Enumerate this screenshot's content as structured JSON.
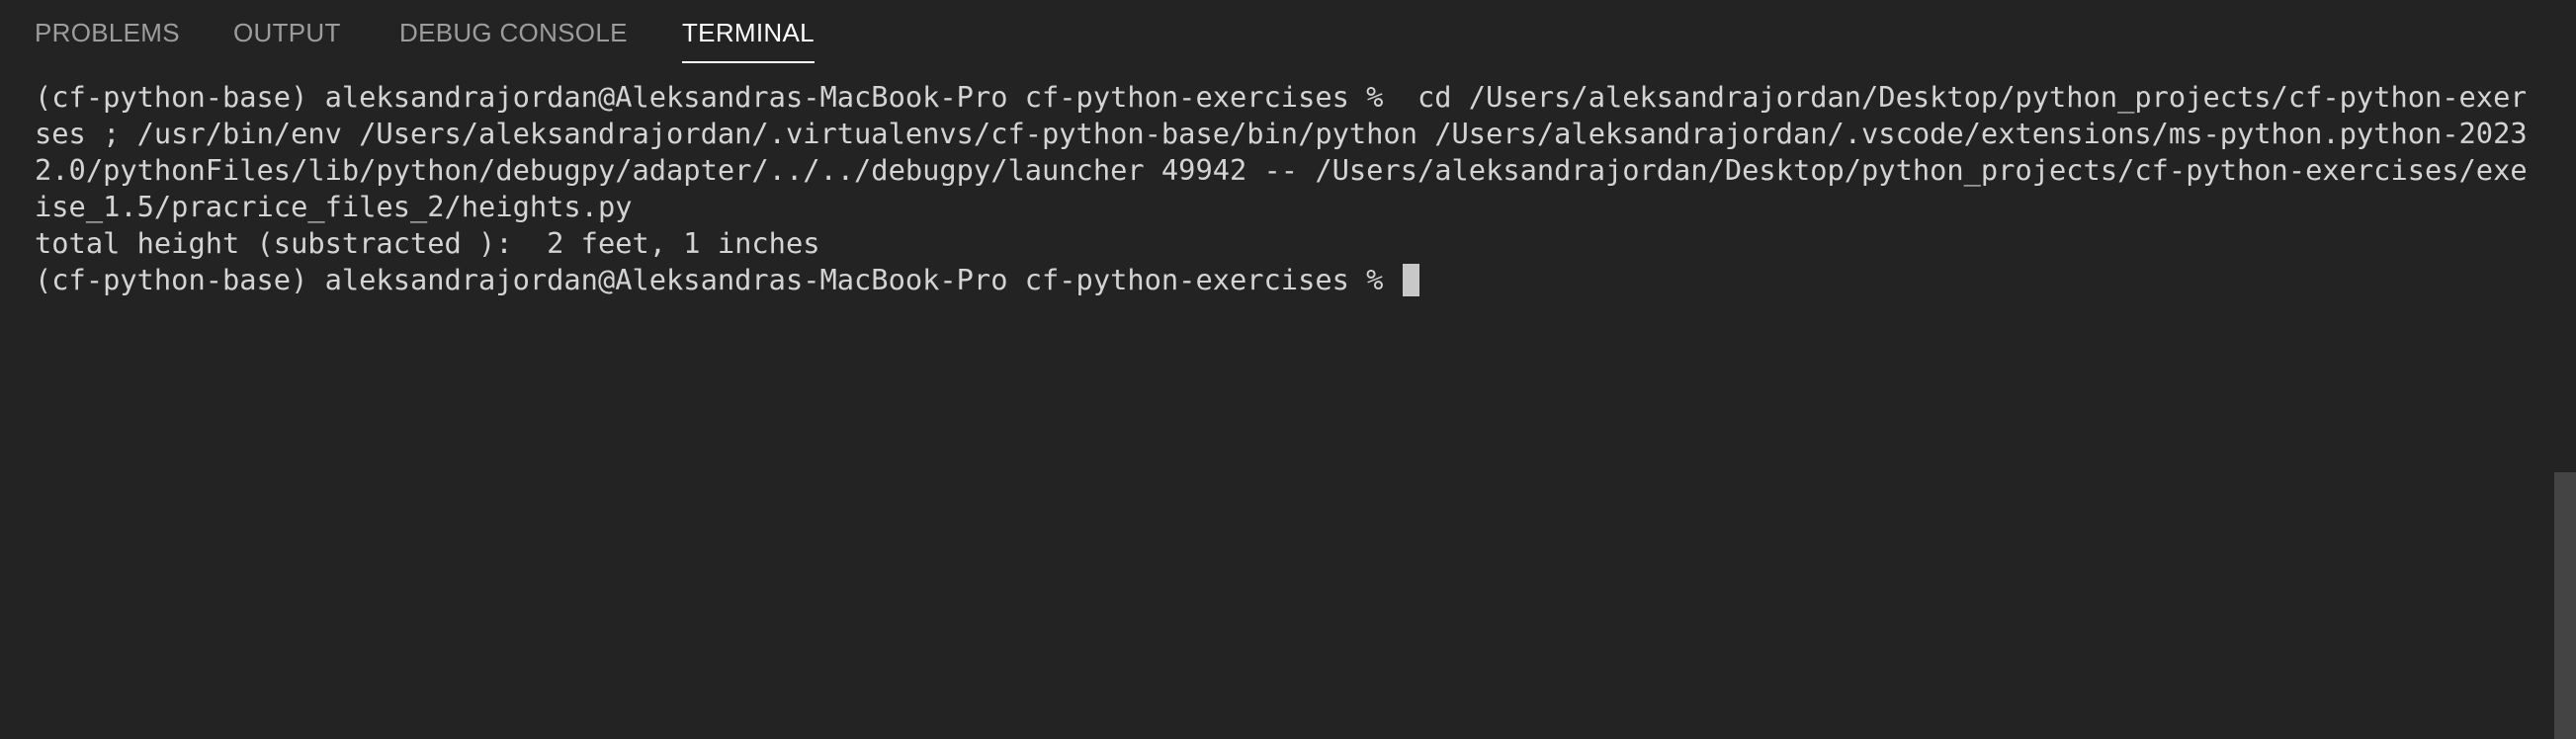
{
  "tabs": [
    {
      "label": "PROBLEMS",
      "active": false
    },
    {
      "label": "OUTPUT",
      "active": false
    },
    {
      "label": "DEBUG CONSOLE",
      "active": false
    },
    {
      "label": "TERMINAL",
      "active": true
    }
  ],
  "terminal": {
    "lines": [
      "(cf-python-base) aleksandrajordan@Aleksandras-MacBook-Pro cf-python-exercises %  cd /Users/aleksandrajordan/Desktop/python_projects/cf-python-exerci",
      "ses ; /usr/bin/env /Users/aleksandrajordan/.virtualenvs/cf-python-base/bin/python /Users/aleksandrajordan/.vscode/extensions/ms-python.python-2023.1",
      "2.0/pythonFiles/lib/python/debugpy/adapter/../../debugpy/launcher 49942 -- /Users/aleksandrajordan/Desktop/python_projects/cf-python-exercises/exerc",
      "ise_1.5/pracrice_files_2/heights.py",
      "total height (substracted ):  2 feet, 1 inches"
    ],
    "prompt": "(cf-python-base) aleksandrajordan@Aleksandras-MacBook-Pro cf-python-exercises % "
  },
  "colors": {
    "background": "#232323",
    "text": "#d4d4d4",
    "tab_inactive": "#9d9d9d",
    "tab_active": "#ffffff"
  }
}
